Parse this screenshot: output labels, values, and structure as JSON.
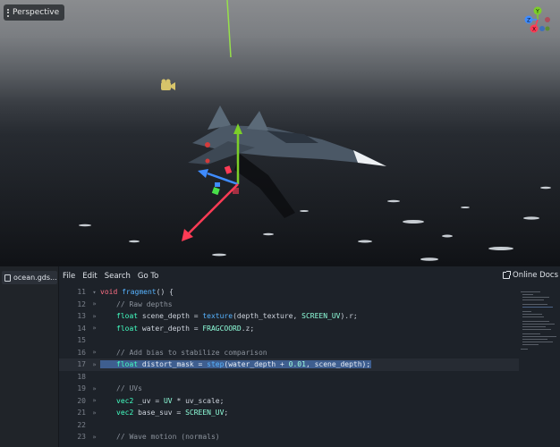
{
  "viewport": {
    "view_mode": "Perspective",
    "gizmo_axes": {
      "y": "Y",
      "z": "Z",
      "x": "X"
    },
    "colors": {
      "axis_x": "#ff3b55",
      "axis_y": "#7ccf29",
      "axis_z": "#3f8cff"
    }
  },
  "editor": {
    "open_file": "ocean.gds...",
    "menu": {
      "file": "File",
      "edit": "Edit",
      "search": "Search",
      "goto": "Go To"
    },
    "online_docs": "Online Docs",
    "current_line": 17,
    "lines": [
      {
        "n": "11",
        "fold": "▾"
      },
      {
        "n": "12",
        "fold": "»"
      },
      {
        "n": "13",
        "fold": "»"
      },
      {
        "n": "14",
        "fold": "»"
      },
      {
        "n": "15",
        "fold": ""
      },
      {
        "n": "16",
        "fold": "»"
      },
      {
        "n": "17",
        "fold": "»"
      },
      {
        "n": "18",
        "fold": ""
      },
      {
        "n": "19",
        "fold": "»"
      },
      {
        "n": "20",
        "fold": "»"
      },
      {
        "n": "21",
        "fold": "»"
      },
      {
        "n": "22",
        "fold": ""
      },
      {
        "n": "23",
        "fold": "»"
      }
    ],
    "code": {
      "l11": {
        "kw": "void",
        "fn": "fragment",
        "rest": "() {"
      },
      "l12": {
        "comment": "// Raw depths"
      },
      "l13": {
        "type": "float",
        "var": " scene_depth = ",
        "fn": "texture",
        "args_a": "(depth_texture, ",
        "builtin": "SCREEN_UV",
        "args_b": ").r;"
      },
      "l14": {
        "type": "float",
        "var": " water_depth = ",
        "builtin": "FRAGCOORD",
        "rest": ".z;"
      },
      "l16": {
        "comment": "// Add bias to stabilize comparison"
      },
      "l17": {
        "type": "float",
        "var": " distort_mask = ",
        "fn": "step",
        "args_a": "(water_depth + ",
        "num": "0.01",
        "args_b": ", scene_depth);"
      },
      "l19": {
        "comment": "// UVs"
      },
      "l20": {
        "type": "vec2",
        "var": " _uv = ",
        "builtin": "UV",
        "rest": " * uv_scale;"
      },
      "l21": {
        "type": "vec2",
        "var": " base_suv = ",
        "builtin": "SCREEN_UV",
        "rest": ";"
      },
      "l23": {
        "comment": "// Wave motion (normals)"
      }
    }
  }
}
